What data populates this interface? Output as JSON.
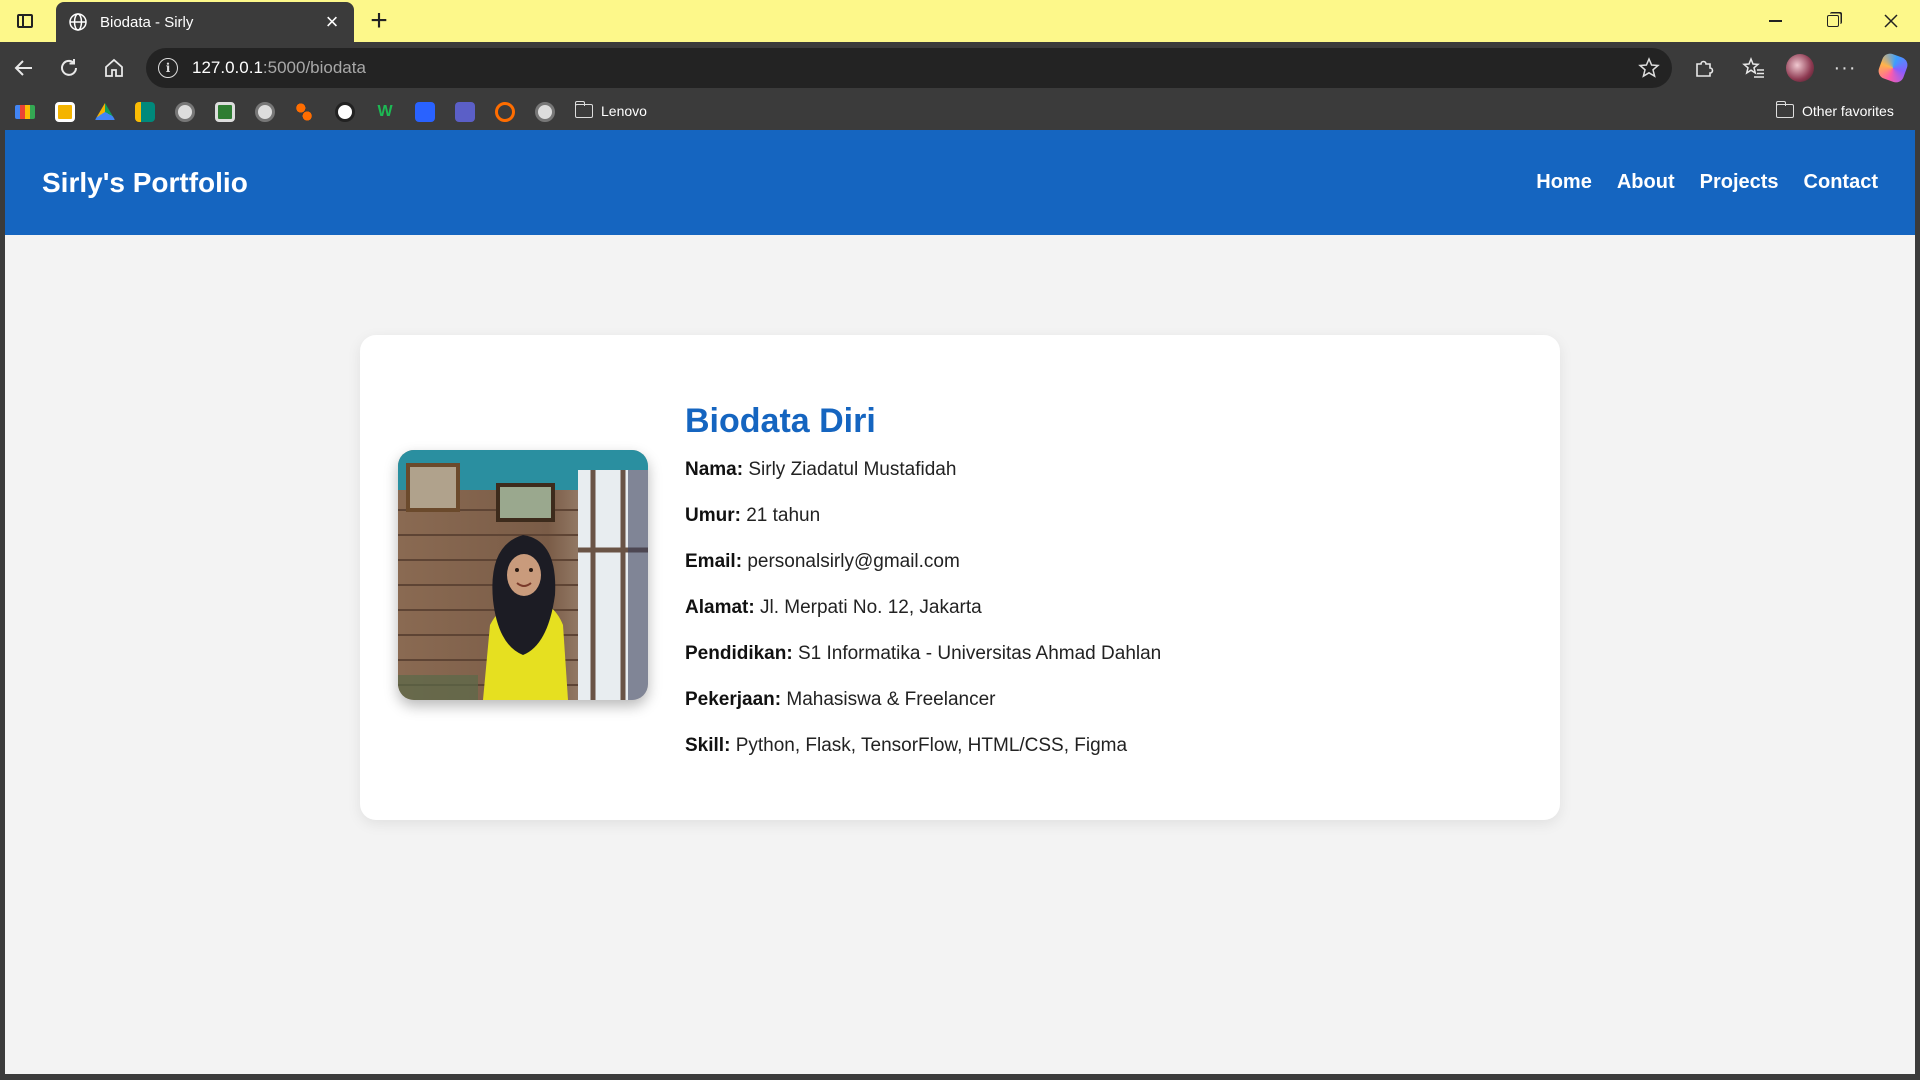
{
  "browser": {
    "tab_title": "Biodata - Sirly",
    "url_host": "127.0.0.1",
    "url_path": ":5000/biodata",
    "bookmark_folder": "Lenovo",
    "other_favorites": "Other favorites"
  },
  "site": {
    "brand": "Sirly's Portfolio",
    "nav": [
      "Home",
      "About",
      "Projects",
      "Contact"
    ]
  },
  "biodata": {
    "title": "Biodata Diri",
    "rows": [
      {
        "label": "Nama:",
        "value": "Sirly Ziadatul Mustafidah"
      },
      {
        "label": "Umur:",
        "value": "21 tahun"
      },
      {
        "label": "Email:",
        "value": "personalsirly@gmail.com"
      },
      {
        "label": "Alamat:",
        "value": "Jl. Merpati No. 12, Jakarta"
      },
      {
        "label": "Pendidikan:",
        "value": "S1 Informatika - Universitas Ahmad Dahlan"
      },
      {
        "label": "Pekerjaan:",
        "value": "Mahasiswa & Freelancer"
      },
      {
        "label": "Skill:",
        "value": "Python, Flask, TensorFlow, HTML/CSS, Figma"
      }
    ]
  },
  "colors": {
    "titlebar": "#fdf88a",
    "chrome": "#3b3b3b",
    "brand_blue": "#1565c0",
    "page_bg": "#f3f3f3"
  }
}
